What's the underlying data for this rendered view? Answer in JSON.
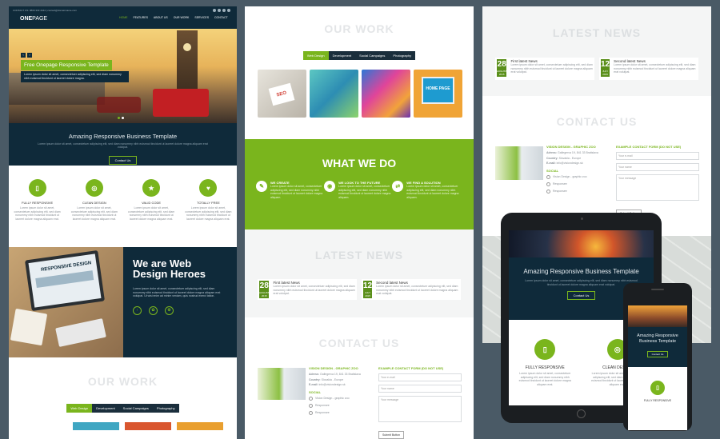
{
  "left": {
    "topbar_text": "CONTACT US: 0800 333 4444 | contact@domainname.com",
    "logo_a": "ONE",
    "logo_b": "PAGE",
    "nav": [
      "HOME",
      "FEATURES",
      "ABOUT US",
      "OUR WORK",
      "SERVICES",
      "CONTACT"
    ],
    "slider_title": "Free Onepage Responsive Template",
    "slider_text": "Lorem ipsum dolor sit amet, consectetuer adipiscing elit, sed diam nonummy nibh euismod tincidunt ut laoreet dolore magna.",
    "band_title": "Amazing Responsive Business Template",
    "band_text": "Lorem ipsum dolor sit amet, consectetuer adipiscing elit, sed diam nonummy nibh euismod tincidunt ut laoreet dolore magna aliquam erat volutpat.",
    "band_button": "Contact Us",
    "features": [
      {
        "title": "FULLY RESPONSIVE",
        "icon": "mobile-icon",
        "text": "Lorem ipsum dolor sit amet, consectetuer adipiscing elit, sed diam nonummy nibh euismod tincidunt ut laoreet dolore magna aliquam erat."
      },
      {
        "title": "CLEAN DESIGN",
        "icon": "target-icon",
        "text": "Lorem ipsum dolor sit amet, consectetuer adipiscing elit, sed diam nonummy nibh euismod tincidunt ut laoreet dolore magna aliquam erat."
      },
      {
        "title": "VALID CODE",
        "icon": "star-icon",
        "text": "Lorem ipsum dolor sit amet, consectetuer adipiscing elit, sed diam nonummy nibh euismod tincidunt ut laoreet dolore magna aliquam erat."
      },
      {
        "title": "TOTALLY FREE",
        "icon": "heart-icon",
        "text": "Lorem ipsum dolor sit amet, consectetuer adipiscing elit, sed diam nonummy nibh euismod tincidunt ut laoreet dolore magna aliquam erat."
      }
    ],
    "heroes_title": "We are Web Design Heroes",
    "heroes_text": "Lorem ipsum dolor sit amet, consectetuer adipiscing elit, sed diam nonummy nibh euismod tincidunt ut laoreet dolore magna aliquam erat volutpat. Ut wisi enim ad minim veniam, quis nostrud exerci tation.",
    "laptop_text": "RESPONSIVE DESIGN",
    "work_title": "OUR WORK",
    "tabs": [
      "Web Design",
      "Development",
      "Social Campaigns",
      "Photography"
    ]
  },
  "middle": {
    "work_title": "OUR WORK",
    "tabs": [
      "Web Design",
      "Development",
      "Social Campaigns",
      "Photography"
    ],
    "thumb_labels": [
      "SEO",
      "HOME PAGE"
    ],
    "whatwedo_title": "WHAT WE DO",
    "whatwedo": [
      {
        "title": "WE CREATE",
        "icon": "compass-icon",
        "text": "Lorem ipsum dolor sit amet, consectetuer adipiscing elit, sed diam nonummy nibh euismod tincidunt ut laoreet dolore magna aliquam."
      },
      {
        "title": "WE LOOK TO THE FUTURE",
        "icon": "eye-icon",
        "text": "Lorem ipsum dolor sit amet, consectetuer adipiscing elit, sed diam nonummy nibh euismod tincidunt ut laoreet dolore magna aliquam."
      },
      {
        "title": "WE FIND A SOLUTION",
        "icon": "shuffle-icon",
        "text": "Lorem ipsum dolor sit amet, consectetuer adipiscing elit, sed diam nonummy nibh euismod tincidunt ut laoreet dolore magna aliquam."
      }
    ],
    "news_title": "LATEST NEWS",
    "news": [
      {
        "day": "28",
        "month": "AUGUST 2015",
        "title": "First latest News",
        "text": "Lorem ipsum dolor sit amet, consectetuer adipiscing elit, sed diam nonummy nibh euismod tincidunt ut laoreet dolore magna aliquam erat volutpat."
      },
      {
        "day": "12",
        "month": "JULY 2015",
        "title": "Second latest News",
        "text": "Lorem ipsum dolor sit amet, consectetuer adipiscing elit, sed diam nonummy nibh euismod tincidunt ut laoreet dolore magna aliquam erat volutpat."
      }
    ],
    "contact_title": "CONTACT US",
    "company": "VISION DESIGN - GRAPHIC ZOO",
    "address_label": "Adress:",
    "address": "Gallegerva 19, 841 33 Bratislava",
    "country_label": "Country:",
    "country": "Slovakia - Europe",
    "email_label": "E-mail:",
    "email": "info@visiondesign.sk",
    "social_label": "SOCIAL",
    "social": [
      "Vision Design - graphic zoo",
      "Responsee",
      "Responsee"
    ],
    "form_title": "EXAMPLE CONTACT FORM (DO NOT USE)",
    "placeholders": [
      "Your e-mail",
      "Your name",
      "Your message"
    ],
    "submit": "Submit Button"
  },
  "right": {
    "news_title": "LATEST NEWS",
    "contact_title": "CONTACT US",
    "tablet_title": "Amazing Responsive Business Template",
    "tablet_text": "Lorem ipsum dolor sit amet, consectetuer adipiscing elit, sed diam nonummy nibh euismod tincidunt ut laoreet dolore magna aliquam erat volutpat.",
    "tablet_button": "Contact Us",
    "tablet_features": [
      "FULLY RESPONSIVE",
      "CLEAN DESIGN"
    ],
    "phone_title": "Amazing Responsive Business Template",
    "phone_button": "Contact Us",
    "phone_feature": "FULLY RESPONSIVE"
  },
  "colors": {
    "accent": "#7ab51d",
    "navy": "#0f2a3a",
    "background": "#4a5a66"
  }
}
